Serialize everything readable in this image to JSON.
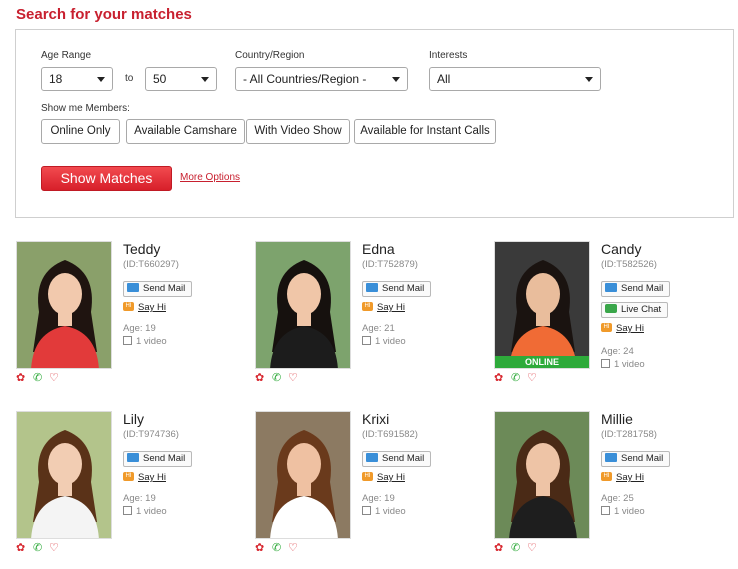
{
  "header": {
    "title": "Search for your matches"
  },
  "search": {
    "age_range_label": "Age Range",
    "age_from": "18",
    "to_label": "to",
    "age_to": "50",
    "country_label": "Country/Region",
    "country_value": "- All Countries/Region -",
    "interests_label": "Interests",
    "interests_value": "All",
    "show_me_label": "Show me Members:",
    "filters": [
      "Online Only",
      "Available Camshare",
      "With Video Show",
      "Available for Instant Calls"
    ],
    "show_matches_label": "Show Matches",
    "more_options_label": "More Options"
  },
  "labels": {
    "send_mail": "Send Mail",
    "say_hi": "Say Hi",
    "live_chat": "Live Chat",
    "online": "ONLINE",
    "hi_badge": "HI"
  },
  "colors": {
    "accent": "#c8202f",
    "button": "#e02b33",
    "online": "#2eaa3a"
  },
  "members": [
    {
      "name": "Teddy",
      "id": "(ID:T660297)",
      "age": "Age: 19",
      "videos": "1 video",
      "online": false,
      "live_chat": false
    },
    {
      "name": "Edna",
      "id": "(ID:T752879)",
      "age": "Age: 21",
      "videos": "1 video",
      "online": false,
      "live_chat": false
    },
    {
      "name": "Candy",
      "id": "(ID:T582526)",
      "age": "Age: 24",
      "videos": "1 video",
      "online": true,
      "live_chat": true
    },
    {
      "name": "Lily",
      "id": "(ID:T974736)",
      "age": "Age: 19",
      "videos": "1 video",
      "online": false,
      "live_chat": false
    },
    {
      "name": "Krixi",
      "id": "(ID:T691582)",
      "age": "Age: 19",
      "videos": "1 video",
      "online": false,
      "live_chat": false
    },
    {
      "name": "Millie",
      "id": "(ID:T281758)",
      "age": "Age: 25",
      "videos": "1 video",
      "online": false,
      "live_chat": false
    }
  ]
}
